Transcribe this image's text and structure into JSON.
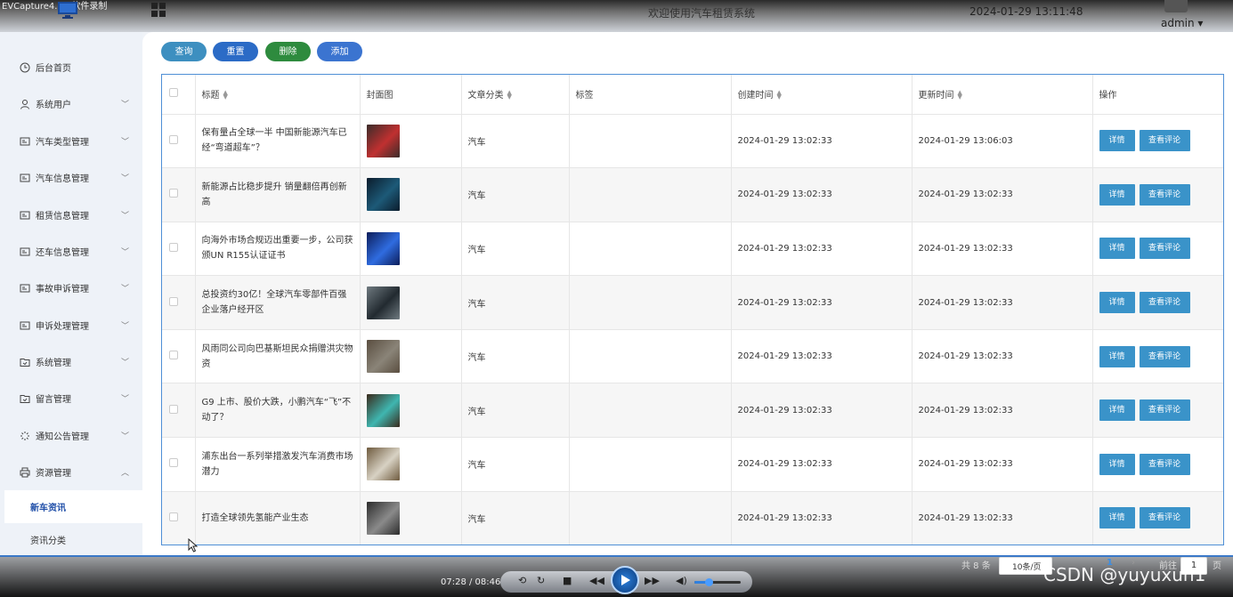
{
  "topbar": {
    "recorder_label": "EVCapture4.1.8软件录制",
    "welcome": "欢迎使用汽车租赁系统",
    "datetime": "2024-01-29 13:11:48",
    "user": "admin ▾"
  },
  "sidebar": {
    "items": [
      {
        "label": "后台首页",
        "icon": "clock-icon",
        "has_children": false
      },
      {
        "label": "系统用户",
        "icon": "user-icon",
        "has_children": true
      },
      {
        "label": "汽车类型管理",
        "icon": "window-icon",
        "has_children": true
      },
      {
        "label": "汽车信息管理",
        "icon": "window-icon",
        "has_children": true
      },
      {
        "label": "租赁信息管理",
        "icon": "window-icon",
        "has_children": true
      },
      {
        "label": "还车信息管理",
        "icon": "window-icon",
        "has_children": true
      },
      {
        "label": "事故申诉管理",
        "icon": "window-icon",
        "has_children": true
      },
      {
        "label": "申诉处理管理",
        "icon": "window-icon",
        "has_children": true
      },
      {
        "label": "系统管理",
        "icon": "folder-icon",
        "has_children": true
      },
      {
        "label": "留言管理",
        "icon": "folder-icon",
        "has_children": true
      },
      {
        "label": "通知公告管理",
        "icon": "loading-icon",
        "has_children": true
      },
      {
        "label": "资源管理",
        "icon": "printer-icon",
        "has_children": true,
        "expanded": true
      }
    ],
    "sub_items": [
      {
        "label": "新车资讯",
        "active": true
      },
      {
        "label": "资讯分类",
        "active": false
      }
    ]
  },
  "toolbar": {
    "query": "查询",
    "reset": "重置",
    "delete": "删除",
    "add": "添加"
  },
  "table": {
    "headers": {
      "title": "标题",
      "cover": "封面图",
      "category": "文章分类",
      "tags": "标签",
      "created": "创建时间",
      "updated": "更新时间",
      "actions": "操作"
    },
    "detail_label": "详情",
    "comment_label": "查看评论",
    "rows": [
      {
        "title": "保有量占全球一半 中国新能源汽车已经“弯道超车”？",
        "category": "汽车",
        "tags": "",
        "created": "2024-01-29 13:02:33",
        "updated": "2024-01-29 13:06:03",
        "thumb_colors": [
          "#3a2c2a",
          "#c03030"
        ]
      },
      {
        "title": "新能源占比稳步提升 销量翻倍再创新高",
        "category": "汽车",
        "tags": "",
        "created": "2024-01-29 13:02:33",
        "updated": "2024-01-29 13:02:33",
        "thumb_colors": [
          "#0b1c2c",
          "#1d5a78"
        ]
      },
      {
        "title": "向海外市场合规迈出重要一步，公司获颁UN R155认证证书",
        "category": "汽车",
        "tags": "",
        "created": "2024-01-29 13:02:33",
        "updated": "2024-01-29 13:02:33",
        "thumb_colors": [
          "#0c1d5a",
          "#2f6ce0"
        ]
      },
      {
        "title": "总投资约30亿！全球汽车零部件百强企业落户经开区",
        "category": "汽车",
        "tags": "",
        "created": "2024-01-29 13:02:33",
        "updated": "2024-01-29 13:02:33",
        "thumb_colors": [
          "#6f7a80",
          "#222a30"
        ]
      },
      {
        "title": "风雨同公司向巴基斯坦民众捐赠洪灾物资",
        "category": "汽车",
        "tags": "",
        "created": "2024-01-29 13:02:33",
        "updated": "2024-01-29 13:02:33",
        "thumb_colors": [
          "#5a4e40",
          "#8a8478"
        ]
      },
      {
        "title": "G9 上市、股价大跌，小鹏汽车“飞”不动了？",
        "category": "汽车",
        "tags": "",
        "created": "2024-01-29 13:02:33",
        "updated": "2024-01-29 13:02:33",
        "thumb_colors": [
          "#3a2a1c",
          "#3fb6b0"
        ]
      },
      {
        "title": "浦东出台一系列举措激发汽车消费市场潜力",
        "category": "汽车",
        "tags": "",
        "created": "2024-01-29 13:02:33",
        "updated": "2024-01-29 13:02:33",
        "thumb_colors": [
          "#6e5a3e",
          "#d8d2c4"
        ]
      },
      {
        "title": "打造全球领先氢能产业生态",
        "category": "汽车",
        "tags": "",
        "created": "2024-01-29 13:02:33",
        "updated": "2024-01-29 13:02:33",
        "thumb_colors": [
          "#2c2c2c",
          "#8a8a8a"
        ]
      }
    ]
  },
  "pager": {
    "total": "共 8 条",
    "page_size": "10条/页",
    "current": "1",
    "goto_label": "前往",
    "goto_value": "1",
    "unit": "页"
  },
  "player": {
    "time": "07:28 / 08:46",
    "volume_fraction": 0.3
  },
  "watermark": "CSDN @yuyuxun1"
}
